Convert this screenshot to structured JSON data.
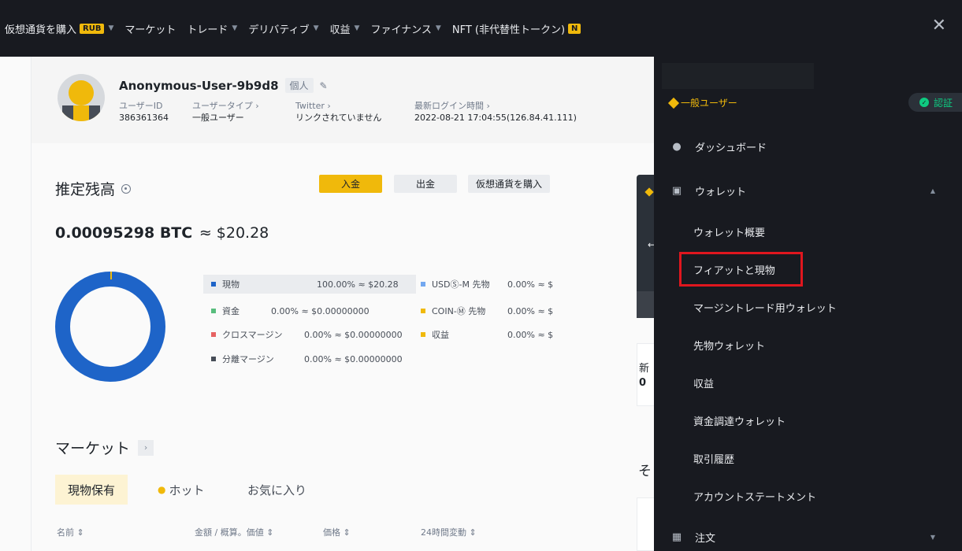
{
  "topnav": {
    "items": [
      {
        "label": "仮想通貨を購入",
        "badge": "RUB",
        "caret": true
      },
      {
        "label": "マーケット",
        "caret": false
      },
      {
        "label": "トレード",
        "caret": true
      },
      {
        "label": "デリバティブ",
        "caret": true
      },
      {
        "label": "収益",
        "caret": true
      },
      {
        "label": "ファイナンス",
        "caret": true
      },
      {
        "label": "NFT (非代替性トークン)",
        "badge": "N",
        "caret": false
      }
    ]
  },
  "user": {
    "name": "Anonymous-User-9b9d8",
    "tag": "個人",
    "fields": [
      {
        "label": "ユーザーID",
        "value": "386361364"
      },
      {
        "label": "ユーザータイプ ›",
        "value": "一般ユーザー"
      },
      {
        "label": "Twitter ›",
        "value": "リンクされていません"
      },
      {
        "label": "最新ログイン時間 ›",
        "value": "2022-08-21 17:04:55(126.84.41.111)"
      }
    ]
  },
  "balance": {
    "title": "推定残高",
    "deposit": "入金",
    "withdraw": "出金",
    "buy": "仮想通貨を購入",
    "btc": "0.00095298 BTC",
    "usd": "≈ $20.28"
  },
  "legend": [
    {
      "name": "現物",
      "value": "100.00% ≈ $20.28",
      "color": "#1e64c8"
    },
    {
      "name": "資金",
      "value": "0.00% ≈ $0.00000000",
      "color": "#58bd7d"
    },
    {
      "name": "クロスマージン",
      "value": "0.00% ≈ $0.00000000",
      "color": "#e66262"
    },
    {
      "name": "分離マージン",
      "value": "0.00% ≈ $0.00000000",
      "color": "#474d57"
    },
    {
      "name": "USDⓈ-M 先物",
      "value": "0.00% ≈ $",
      "color": "#73a8f0"
    },
    {
      "name": "COIN-Ⓜ 先物",
      "value": "0.00% ≈ $",
      "color": "#f0b90b"
    },
    {
      "name": "収益",
      "value": "0.00% ≈ $",
      "color": "#f0b90b"
    }
  ],
  "market": {
    "title": "マーケット",
    "tabs": [
      "現物保有",
      "ホット",
      "お気に入り"
    ],
    "columns": [
      "名前 ⇕",
      "金額 / 概算。価値 ⇕",
      "価格 ⇕",
      "24時間変動 ⇕"
    ]
  },
  "rightpartial": {
    "card2_line1": "新",
    "card2_line2": "0",
    "section": "そ"
  },
  "panel": {
    "level": "一般ユーザー",
    "verify": "認証",
    "items": [
      {
        "label": "ダッシュボード"
      },
      {
        "label": "ウォレット"
      },
      {
        "label": "ウォレット概要"
      },
      {
        "label": "フィアットと現物"
      },
      {
        "label": "マージントレード用ウォレット"
      },
      {
        "label": "先物ウォレット"
      },
      {
        "label": "収益"
      },
      {
        "label": "資金調達ウォレット"
      },
      {
        "label": "取引履歴"
      },
      {
        "label": "アカウントステートメント"
      },
      {
        "label": "注文"
      }
    ]
  }
}
